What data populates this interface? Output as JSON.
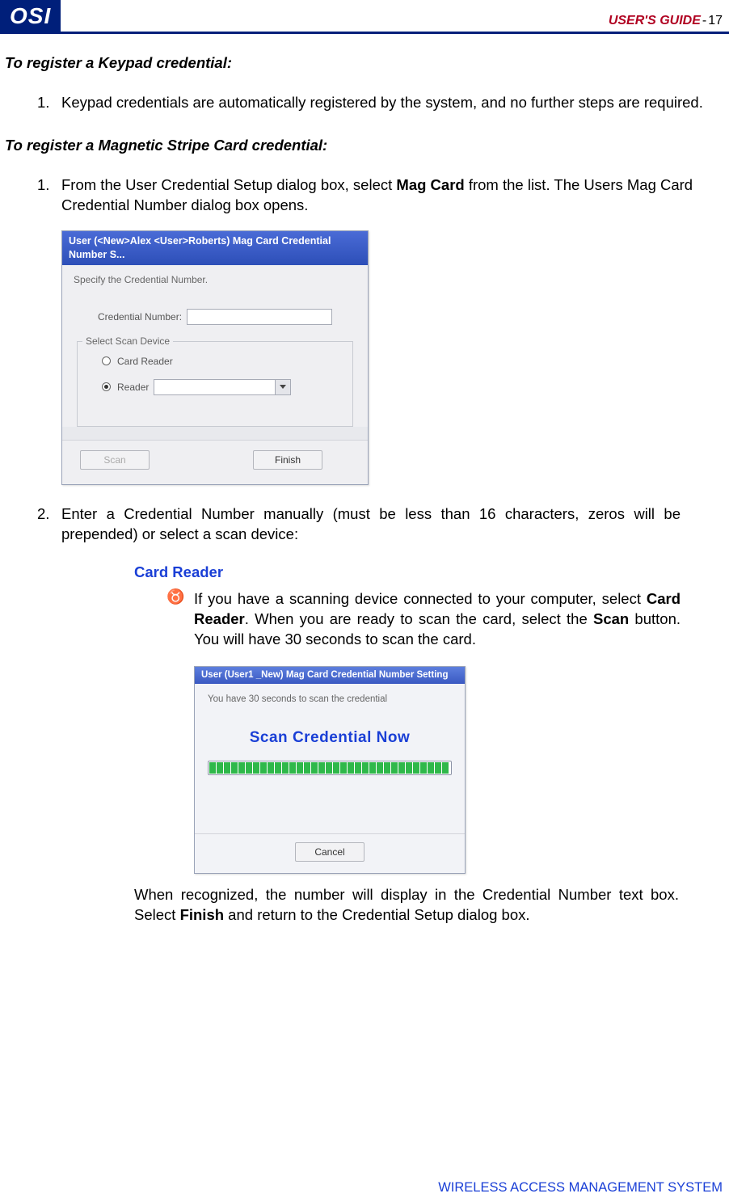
{
  "header": {
    "logo": "OSI",
    "guide": "USER'S GUIDE",
    "pageSep": "-",
    "pageNum": "17"
  },
  "section1": {
    "heading": "To register a Keypad credential:",
    "item1_num": "1.",
    "item1_text": "Keypad credentials are automatically registered by the system, and no further steps are required."
  },
  "section2": {
    "heading": "To register a Magnetic Stripe Card credential:",
    "item1_num": "1.",
    "item1_pre": "From the User Credential Setup dialog box, select ",
    "item1_bold": "Mag Card",
    "item1_post": " from the list.   The Users Mag Card Credential Number dialog box opens.",
    "item2_num": "2.",
    "item2_text": "Enter a Credential Number manually (must be less than 16 characters, zeros will be prepended) or select a scan device:"
  },
  "dialog1": {
    "title": "User (<New>Alex <User>Roberts) Mag Card Credential Number S...",
    "instruction": "Specify the Credential Number.",
    "credential_label": "Credential Number:",
    "group_legend": "Select Scan Device",
    "radio_card_reader": "Card Reader",
    "radio_reader": "Reader",
    "btn_scan": "Scan",
    "btn_finish": "Finish"
  },
  "cardreader": {
    "heading": "Card Reader",
    "bullet_pre": "If you have a scanning device connected to your computer, select ",
    "bullet_b1": "Card Reader",
    "bullet_mid": ".   When you are ready to scan the card, select the ",
    "bullet_b2": "Scan",
    "bullet_post": " button.   You will have 30 seconds to scan the card.",
    "after_pre": "When recognized, the number will display in the Credential Number text box. Select ",
    "after_b": "Finish",
    "after_post": " and return to the Credential Setup dialog box."
  },
  "dialog2": {
    "title": "User (User1 _New) Mag Card Credential Number Setting",
    "instruction": "You have 30 seconds to scan the credential",
    "scan_now": "Scan Credential Now",
    "btn_cancel": "Cancel"
  },
  "footer": "WIRELESS ACCESS MANAGEMENT SYSTEM",
  "glyphs": {
    "taurus": "♉"
  }
}
